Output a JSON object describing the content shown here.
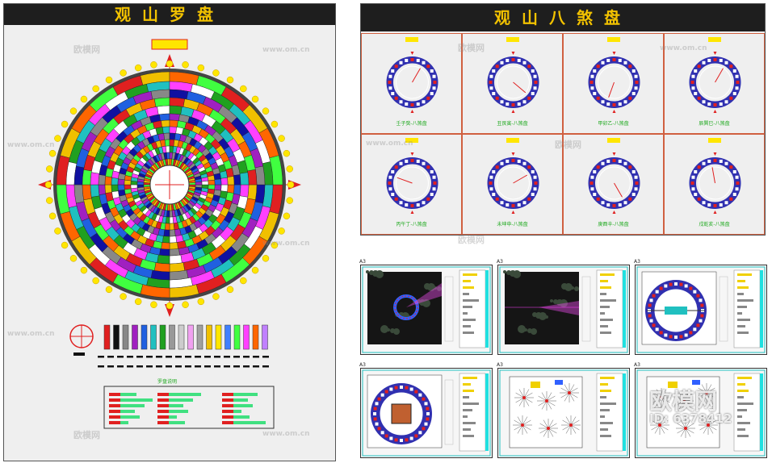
{
  "left_panel": {
    "title": "观山罗盘",
    "legend_caption": "罗盘说明"
  },
  "right_panel": {
    "title": "观山八煞盘",
    "cells": [
      {
        "label": "壬子癸-八煞盘"
      },
      {
        "label": "丑艮寅-八煞盘"
      },
      {
        "label": "甲卯乙-八煞盘"
      },
      {
        "label": "辰巽巳-八煞盘"
      },
      {
        "label": "丙午丁-八煞盘"
      },
      {
        "label": "未坤申-八煞盘"
      },
      {
        "label": "庚酉辛-八煞盘"
      },
      {
        "label": "戌乾亥-八煞盘"
      }
    ]
  },
  "sheets": [
    {
      "label": "A3"
    },
    {
      "label": "A3"
    },
    {
      "label": "A3"
    },
    {
      "label": "A3"
    },
    {
      "label": "A3"
    },
    {
      "label": "A3"
    }
  ],
  "watermarks": {
    "site": "www.om.cn",
    "brand": "欧模网",
    "id_text": "ID: 6378412"
  },
  "colors": {
    "title_bg": "#1e1e1e",
    "title_text": "#f2c200",
    "grid_line": "#d06040",
    "ring_blue": "#3030b0",
    "accent_red": "#e02020"
  }
}
